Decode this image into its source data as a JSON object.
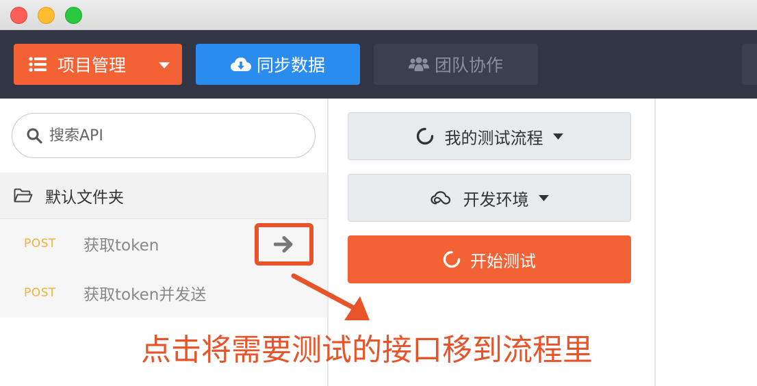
{
  "toolbar": {
    "project_label": "项目管理",
    "sync_label": "同步数据",
    "team_label": "团队协作"
  },
  "sidebar": {
    "search_placeholder": "搜索API",
    "folder_label": "默认文件夹",
    "items": [
      {
        "method": "POST",
        "name": "获取token"
      },
      {
        "method": "POST",
        "name": "获取token并发送"
      }
    ]
  },
  "flow": {
    "flow_select_label": "我的测试流程",
    "env_select_label": "开发环境",
    "start_label": "开始测试"
  },
  "annotation": {
    "text": "点击将需要测试的接口移到流程里"
  },
  "colors": {
    "accent_orange": "#f26234",
    "sync_blue": "#2b8cf0",
    "toolbar_dark": "#323644",
    "method_post": "#f3b236",
    "annotation": "#e8532a"
  },
  "icons": {
    "project": "list-icon",
    "sync": "cloud-download-icon",
    "team": "users-icon",
    "search": "search-icon",
    "folder": "folder-open-icon",
    "move": "arrow-right-icon",
    "flow": "spinner-icon",
    "env": "cloud-outline-icon",
    "start": "spinner-icon"
  }
}
